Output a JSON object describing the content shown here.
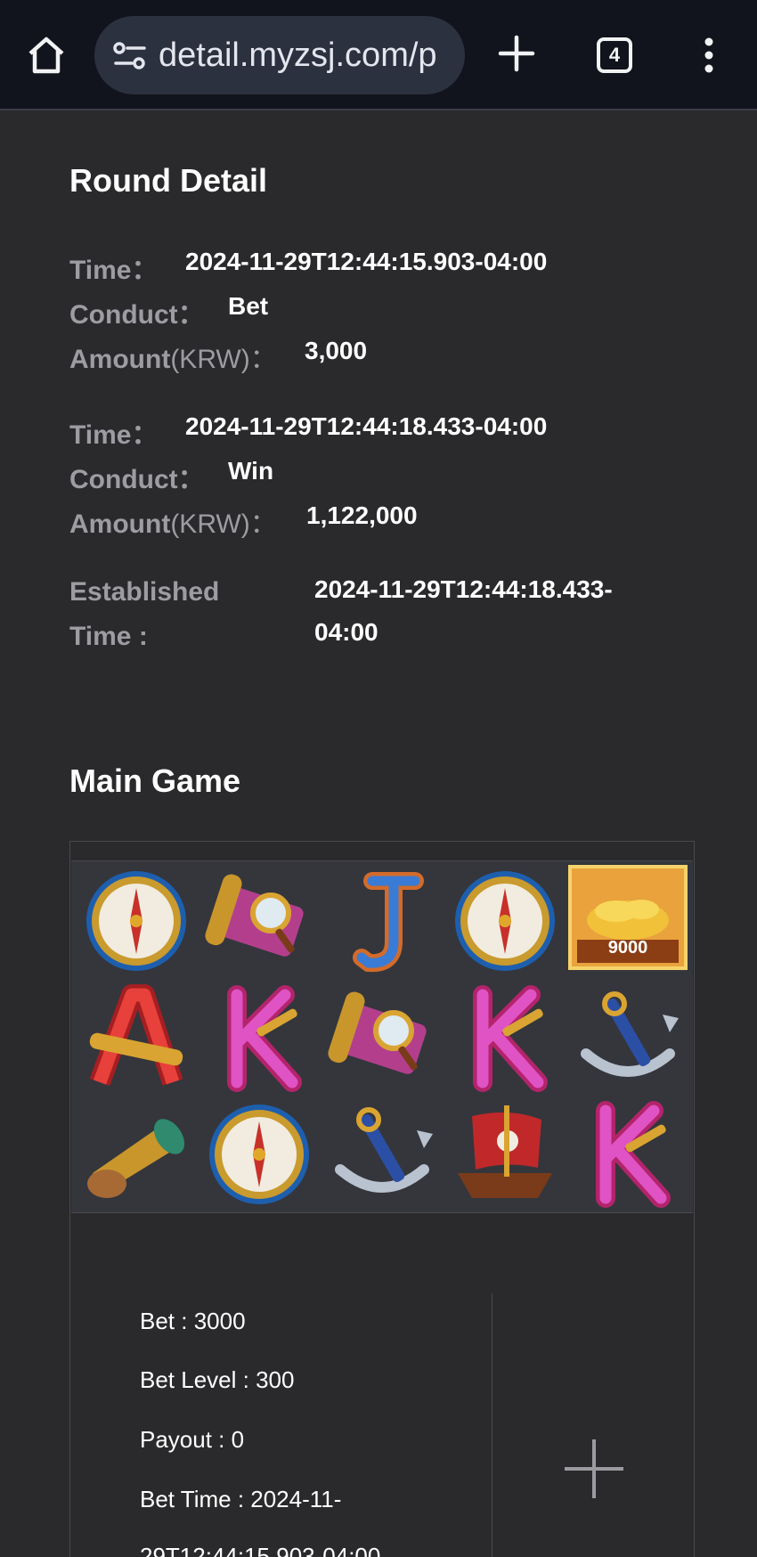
{
  "browser": {
    "url": "detail.myzsj.com/p",
    "tab_count": "4",
    "icons": [
      "home-icon",
      "site-settings-icon",
      "new-tab-icon",
      "tab-switcher-icon",
      "more-menu-icon"
    ]
  },
  "round_detail": {
    "title": "Round Detail",
    "entries": [
      {
        "time_label": "Time：",
        "time": "2024-11-29T12:44:15.903-04:00",
        "conduct_label": "Conduct：",
        "conduct": "Bet",
        "amount_label": "Amount",
        "amount_unit": "(KRW)：",
        "amount": "3,000"
      },
      {
        "time_label": "Time：",
        "time": "2024-11-29T12:44:18.433-04:00",
        "conduct_label": "Conduct：",
        "conduct": "Win",
        "amount_label": "Amount",
        "amount_unit": "(KRW)：",
        "amount": "1,122,000"
      }
    ],
    "established_label_1": "Established",
    "established_label_2": "Time :",
    "established_value_1": "2024-11-29T12:44:18.433-",
    "established_value_2": "04:00"
  },
  "main_game": {
    "title": "Main Game",
    "reels": [
      [
        "compass",
        "treasure-map",
        "letter-j",
        "compass",
        "gold-coins"
      ],
      [
        "letter-a",
        "letter-k",
        "treasure-map",
        "letter-k",
        "anchor"
      ],
      [
        "spyglass",
        "compass",
        "anchor",
        "pirate-ship",
        "letter-k"
      ]
    ],
    "gold_coins_value": "9000",
    "details": {
      "bet": "Bet : 3000",
      "bet_level": "Bet Level : 300",
      "payout": "Payout : 0",
      "bet_time_1": "Bet Time : 2024-11-",
      "bet_time_2": "29T12:44:15.903-04:00"
    }
  },
  "colors": {
    "page_bg": "#2a2a2c",
    "topbar_bg": "#11141d",
    "label": "#9c9ca2",
    "reel_bg": "#34363c"
  }
}
